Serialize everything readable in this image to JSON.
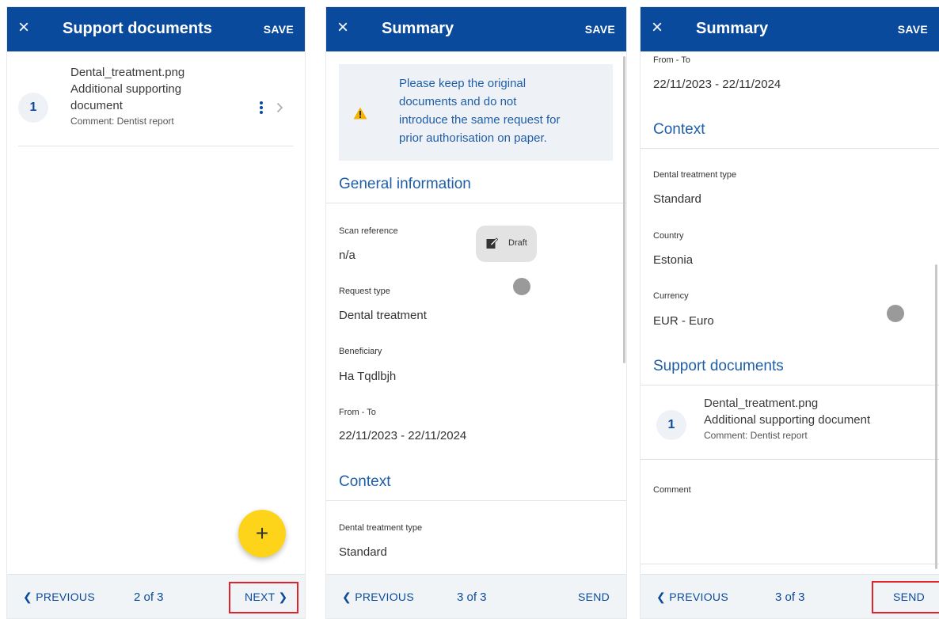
{
  "panel1": {
    "header": {
      "close": "×",
      "title": "Support documents",
      "save": "SAVE"
    },
    "document": {
      "number": "1",
      "filename": "Dental_treatment.png",
      "type_line1": "Additional supporting",
      "type_line2": "document",
      "comment": "Comment: Dentist report"
    },
    "fab_label": "+",
    "footer": {
      "previous": "❮ PREVIOUS",
      "page": "2 of 3",
      "next": "NEXT ❯"
    }
  },
  "panel2": {
    "header": {
      "close": "×",
      "title": "Summary",
      "save": "SAVE"
    },
    "warning": {
      "line1": "Please keep the original",
      "line2": "documents and do not",
      "line3": "introduce the same request for",
      "line4": "prior authorisation on paper."
    },
    "general_title": "General information",
    "status_badge": "Draft",
    "fields": {
      "scan_label": "Scan reference",
      "scan_value": "n/a",
      "request_label": "Request type",
      "request_value": "Dental treatment",
      "beneficiary_label": "Beneficiary",
      "beneficiary_value": "Ha Tqdlbjh",
      "fromto_label": "From - To",
      "fromto_value": "22/11/2023 - 22/11/2024"
    },
    "context_title": "Context",
    "context": {
      "treatment_label": "Dental treatment type",
      "treatment_value": "Standard"
    },
    "footer": {
      "previous": "❮ PREVIOUS",
      "page": "3 of 3",
      "send": "SEND"
    }
  },
  "panel3": {
    "header": {
      "close": "×",
      "title": "Summary",
      "save": "SAVE"
    },
    "fromto_label": "From - To",
    "fromto_value": "22/11/2023 - 22/11/2024",
    "context_title": "Context",
    "context": {
      "treatment_label": "Dental treatment type",
      "treatment_value": "Standard",
      "country_label": "Country",
      "country_value": "Estonia",
      "currency_label": "Currency",
      "currency_value": "EUR - Euro"
    },
    "support_title": "Support documents",
    "document": {
      "number": "1",
      "filename": "Dental_treatment.png",
      "type": "Additional supporting document",
      "comment": "Comment: Dentist report"
    },
    "comment_label": "Comment",
    "footer": {
      "previous": "❮ PREVIOUS",
      "page": "3 of 3",
      "send": "SEND"
    }
  },
  "colors": {
    "header": "#0a4a9c",
    "accent": "#1f5ea8",
    "fab": "#fed41b",
    "highlight": "#e0242b",
    "warning": "#f4b400"
  }
}
